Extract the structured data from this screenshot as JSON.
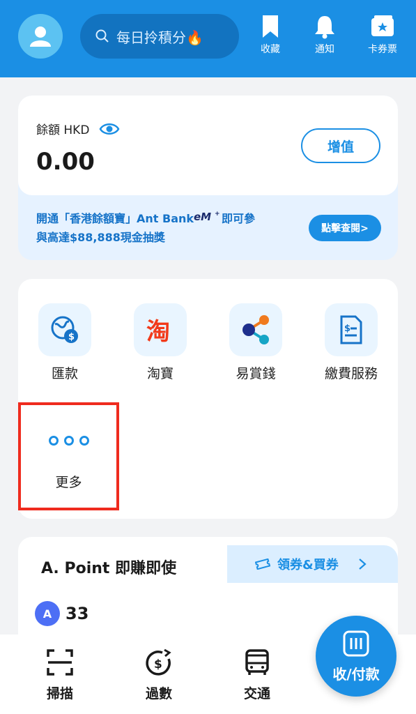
{
  "header": {
    "search_placeholder": "每日拎積分🔥",
    "icons": [
      {
        "label": "收藏",
        "icon": "bookmark-icon"
      },
      {
        "label": "通知",
        "icon": "bell-icon"
      },
      {
        "label": "卡券票",
        "icon": "ticket-icon"
      }
    ]
  },
  "balance": {
    "label": "餘額 HKD",
    "value": "0.00",
    "topup_label": "增值"
  },
  "promo": {
    "line1": "開通「香港餘額寶」Ant Bank",
    "line1_tail": "即可參",
    "line2": "與高達$88,888現金抽獎",
    "button_label": "點擊查閱>"
  },
  "services": {
    "items": [
      {
        "label": "匯款",
        "icon": "remittance-icon"
      },
      {
        "label": "淘寶",
        "icon": "taobao-icon"
      },
      {
        "label": "易賞錢",
        "icon": "share-icon"
      },
      {
        "label": "繳費服務",
        "icon": "bill-icon"
      }
    ],
    "more_label": "更多"
  },
  "points": {
    "title": "A. Point 即賺即使",
    "coupon_label": "領券&買券",
    "badge": "A",
    "value": "33"
  },
  "bottom_nav": {
    "items": [
      {
        "label": "掃描",
        "icon": "scan-icon"
      },
      {
        "label": "過數",
        "icon": "transfer-icon"
      },
      {
        "label": "交通",
        "icon": "bus-icon"
      }
    ],
    "pay_label": "收/付款"
  },
  "colors": {
    "primary": "#1b8fe4",
    "highlight": "#ef2b1e"
  }
}
